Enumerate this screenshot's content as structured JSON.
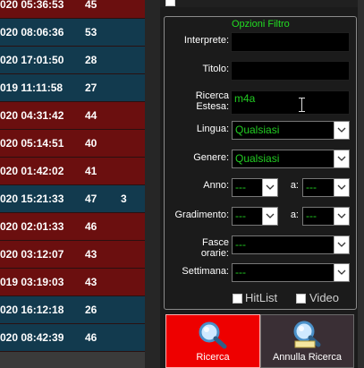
{
  "list": {
    "rows": [
      {
        "datetime": "020 05:36:53",
        "count": "45",
        "extra": "",
        "color": "#6b0f0f"
      },
      {
        "datetime": "020 08:06:36",
        "count": "53",
        "extra": "",
        "color": "#123a4e"
      },
      {
        "datetime": "020 17:01:50",
        "count": "28",
        "extra": "",
        "color": "#123a4e"
      },
      {
        "datetime": "019 11:11:58",
        "count": "27",
        "extra": "",
        "color": "#123a4e"
      },
      {
        "datetime": "020 04:31:42",
        "count": "44",
        "extra": "",
        "color": "#6b0f0f"
      },
      {
        "datetime": "020 05:14:51",
        "count": "40",
        "extra": "",
        "color": "#6b0f0f"
      },
      {
        "datetime": "020 01:42:02",
        "count": "41",
        "extra": "",
        "color": "#6b0f0f"
      },
      {
        "datetime": "020 15:21:33",
        "count": "47",
        "extra": "3",
        "color": "#123a4e"
      },
      {
        "datetime": "020 02:01:33",
        "count": "46",
        "extra": "",
        "color": "#6b0f0f"
      },
      {
        "datetime": "020 03:12:07",
        "count": "43",
        "extra": "",
        "color": "#6b0f0f"
      },
      {
        "datetime": "019 03:19:03",
        "count": "43",
        "extra": "",
        "color": "#6b0f0f"
      },
      {
        "datetime": "020 16:12:18",
        "count": "26",
        "extra": "",
        "color": "#123a4e"
      },
      {
        "datetime": "020 08:42:39",
        "count": "46",
        "extra": "",
        "color": "#123a4e"
      }
    ]
  },
  "filter": {
    "title": "Opzioni Filtro",
    "interprete_label": "Interprete:",
    "interprete_value": "",
    "titolo_label": "Titolo:",
    "titolo_value": "",
    "ricerca_label_1": "Ricerca",
    "ricerca_label_2": "Estesa:",
    "ricerca_value": "m4a",
    "lingua_label": "Lingua:",
    "lingua_value": "Qualsiasi",
    "genere_label": "Genere:",
    "genere_value": "Qualsiasi",
    "anno_label": "Anno:",
    "anno_from": "---",
    "anno_a": "a:",
    "anno_to": "---",
    "gradimento_label": "Gradimento:",
    "grad_from": "---",
    "grad_a": "a:",
    "grad_to": "---",
    "fasce_label": "Fasce orarie:",
    "fasce_value": "---",
    "settimana_label": "Settimana:",
    "settimana_value": "---",
    "hitlist_label": "HitList",
    "video_label": "Video"
  },
  "buttons": {
    "ricerca_label": "Ricerca",
    "annulla_label": "Annulla Ricerca"
  },
  "colors": {
    "accent_green": "#22cc22",
    "search_button": "#ee0000",
    "cancel_button": "#3a2f35"
  }
}
